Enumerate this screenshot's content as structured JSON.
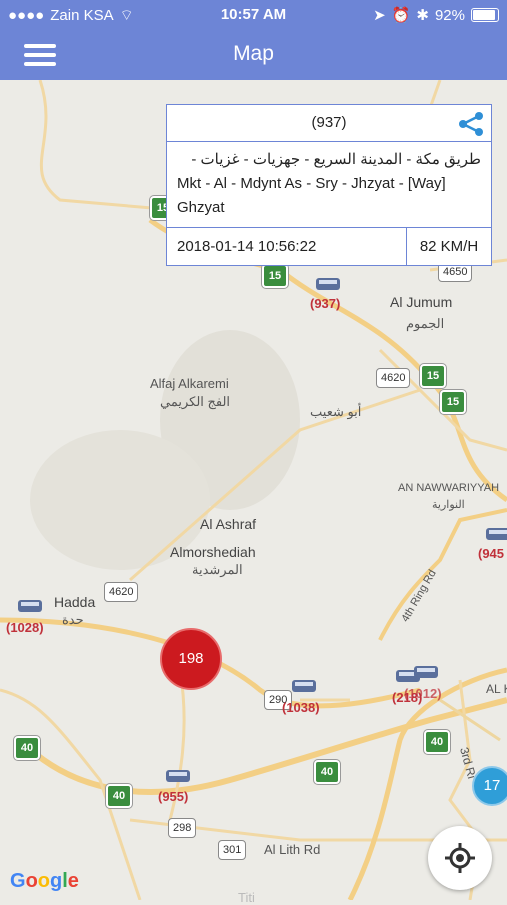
{
  "status_bar": {
    "carrier": "Zain KSA",
    "time": "10:57 AM",
    "battery": "92%"
  },
  "nav": {
    "title": "Map"
  },
  "info_card": {
    "vehicle_id": "(937)",
    "address_arabic": "طريق مكة  -  المدينة السريع - جهزيات - غزيات -",
    "address_line2": "Mkt  -  Al - Mdynt As - Sry - Jhzyat -  [Way]",
    "address_line3": "Ghzyat",
    "datetime": "2018-01-14 10:56:22",
    "speed": "82 KM/H"
  },
  "map": {
    "places": {
      "al_jumum": "Al Jumum",
      "al_jumum_ar": "الجموم",
      "alfaj": "Alfaj Alkaremi",
      "alfaj_ar": "الفج الكريمي",
      "abu_shuayb_ar": "أبو شعيب",
      "nawwariyyah": "AN NAWWARIYYAH",
      "nawwariyyah_ar": "النوارية",
      "al_ashraf": "Al Ashraf",
      "almorshediah": "Almorshediah",
      "almorshediah_ar": "المرشدية",
      "hadda": "Hadda",
      "hadda_ar": "حدة",
      "ring_4th": "4th Ring Rd",
      "ring_3rd": "3rd Ri",
      "al_lith": "Al Lith Rd",
      "alk": "AL K",
      "tit": "Titi"
    },
    "vehicle_labels": {
      "v937": "(937)",
      "v945": "(945",
      "v1028": "(1028)",
      "v1038": "(1038)",
      "v218": "(218)",
      "v1012": "(1012)",
      "v955": "(955)"
    },
    "shields": {
      "s15a": "15",
      "s15b": "15",
      "s15c": "15",
      "s15d": "15",
      "s40a": "40",
      "s40b": "40",
      "s40c": "40",
      "s40d": "40"
    },
    "road_numbers": {
      "r4650": "4650",
      "r4620a": "4620",
      "r4620b": "4620",
      "r298": "298",
      "r301": "301",
      "r290": "290"
    },
    "clusters": {
      "c198": "198",
      "c17": "17"
    },
    "google": "Google"
  }
}
